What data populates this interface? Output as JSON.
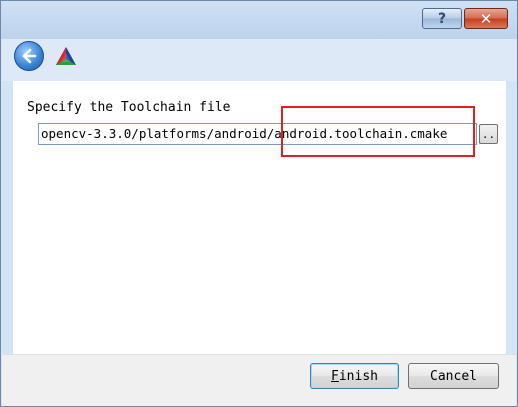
{
  "window": {
    "help_label": "?",
    "close_label": "✕"
  },
  "header": {
    "back_icon": "back-arrow-icon",
    "logo_icon": "cmake-logo-icon"
  },
  "content": {
    "prompt": "Specify the Toolchain file",
    "path_value": "opencv-3.3.0/platforms/android/android.toolchain.cmake",
    "browse_label": ".."
  },
  "footer": {
    "finish_label": "Finish",
    "cancel_label": "Cancel"
  },
  "colors": {
    "highlight": "#e02020",
    "title_bar": "#cfe1f4",
    "close_button": "#c4401f"
  }
}
